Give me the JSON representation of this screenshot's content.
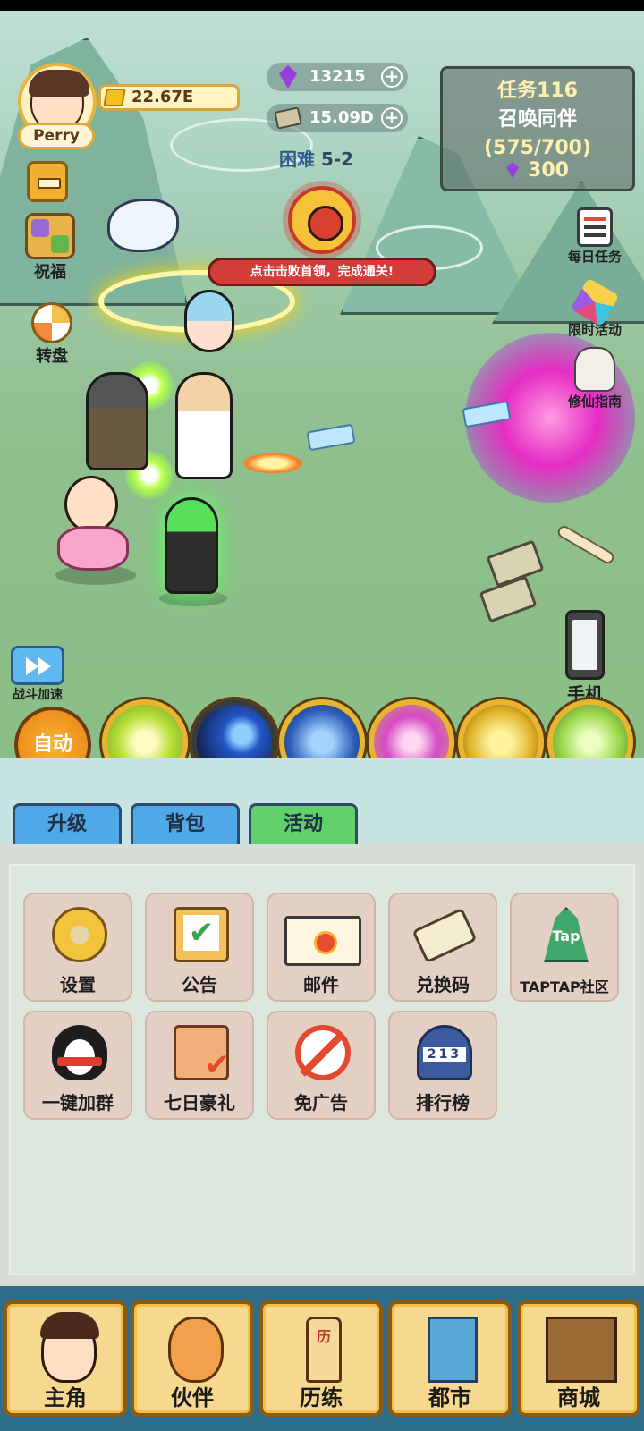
{
  "player": {
    "name": "Perry",
    "gold": "22.67E"
  },
  "currencies": {
    "gems": "13215",
    "cash": "15.09D",
    "plus": "+"
  },
  "stage": {
    "difficulty": "困难",
    "level": "5-2"
  },
  "task": {
    "title": "任务116",
    "name": "召唤同伴",
    "progress": "(575/700)",
    "reward": "300"
  },
  "boss": {
    "tip": "点击击败首领，完成通关!"
  },
  "left_icons": {
    "bless": "祝福",
    "wheel": "转盘",
    "speed": "战斗加速"
  },
  "right_icons": {
    "daily": "每日任务",
    "limited": "限时活动",
    "guide": "修仙指南",
    "phone": "手机"
  },
  "skills": {
    "auto": "自动"
  },
  "tabs": [
    {
      "label": "升级"
    },
    {
      "label": "背包"
    },
    {
      "label": "活动",
      "active": true
    }
  ],
  "menu": [
    {
      "label": "设置",
      "icon": "gear-icon"
    },
    {
      "label": "公告",
      "icon": "clipboard-icon"
    },
    {
      "label": "邮件",
      "icon": "envelope-icon"
    },
    {
      "label": "兑换码",
      "icon": "ticket-icon"
    },
    {
      "label": "TAPTAP社区",
      "icon": "taptap-icon",
      "icon_text": "Tap"
    },
    {
      "label": "一键加群",
      "icon": "qq-penguin-icon"
    },
    {
      "label": "七日豪礼",
      "icon": "scroll-check-icon"
    },
    {
      "label": "免广告",
      "icon": "no-ads-icon"
    },
    {
      "label": "排行榜",
      "icon": "podium-icon"
    }
  ],
  "bottom_nav": [
    {
      "label": "主角",
      "icon": "hero-icon"
    },
    {
      "label": "伙伴",
      "icon": "cat-icon"
    },
    {
      "label": "历练",
      "icon": "training-sign-icon",
      "icon_text": "历"
    },
    {
      "label": "都市",
      "icon": "city-icon"
    },
    {
      "label": "商城",
      "icon": "shop-stall-icon"
    }
  ],
  "colors": {
    "accent_gold": "#e9b42f",
    "tab_blue": "#4fa8e8",
    "tab_green": "#62d06a",
    "nav_bg": "#2d6f8a",
    "boss_red": "#d23d3a"
  }
}
